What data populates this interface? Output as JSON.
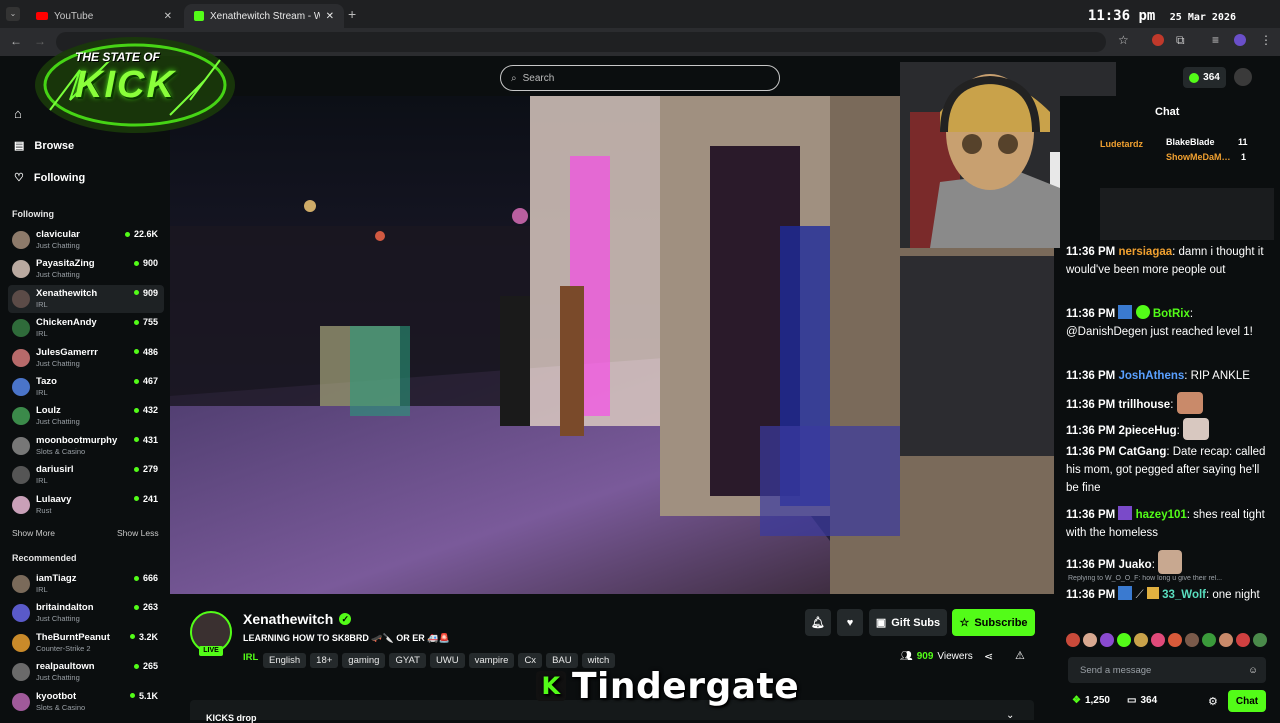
{
  "browser": {
    "tabs": [
      {
        "label": "YouTube",
        "icon": "youtube-icon"
      },
      {
        "label": "Xenathewitch Stream - Wa…",
        "icon": "kick-icon"
      }
    ],
    "clock_time": "11:36 pm",
    "clock_date": "25 Mar 2026"
  },
  "overlay_logo": {
    "line1": "THE STATE OF",
    "line2": "KICK"
  },
  "header": {
    "search_placeholder": "Search",
    "points": "364"
  },
  "sidebar": {
    "nav": [
      {
        "label": "Browse",
        "icon": "compass-icon"
      },
      {
        "label": "Following",
        "icon": "heart-icon"
      }
    ],
    "following_title": "Following",
    "following": [
      {
        "name": "clavicular",
        "category": "Just Chatting",
        "viewers": "22.6K",
        "color": "#8d7a6a"
      },
      {
        "name": "PayasitaZing",
        "category": "Just Chatting",
        "viewers": "900",
        "color": "#b9a9a0"
      },
      {
        "name": "Xenathewitch",
        "category": "IRL",
        "viewers": "909",
        "color": "#5b4b47"
      },
      {
        "name": "ChickenAndy",
        "category": "IRL",
        "viewers": "755",
        "color": "#2f6b3a"
      },
      {
        "name": "JulesGamerrr",
        "category": "Just Chatting",
        "viewers": "486",
        "color": "#b76a6a"
      },
      {
        "name": "Tazo",
        "category": "IRL",
        "viewers": "467",
        "color": "#4a74c9"
      },
      {
        "name": "Loulz",
        "category": "Just Chatting",
        "viewers": "432",
        "color": "#3b8a4a"
      },
      {
        "name": "moonbootmurphy",
        "category": "Slots & Casino",
        "viewers": "431",
        "color": "#777"
      },
      {
        "name": "dariusirl",
        "category": "IRL",
        "viewers": "279",
        "color": "#555"
      },
      {
        "name": "Lulaavy",
        "category": "Rust",
        "viewers": "241",
        "color": "#c9a0b8"
      }
    ],
    "show_more": "Show More",
    "show_less": "Show Less",
    "recommended_title": "Recommended",
    "recommended": [
      {
        "name": "iamTiagz",
        "category": "IRL",
        "viewers": "666",
        "color": "#7a6a5a"
      },
      {
        "name": "britaindalton",
        "category": "Just Chatting",
        "viewers": "263",
        "color": "#5a5ac9"
      },
      {
        "name": "TheBurntPeanut",
        "category": "Counter-Strike 2",
        "viewers": "3.2K",
        "color": "#c98a2a"
      },
      {
        "name": "realpaultown",
        "category": "Just Chatting",
        "viewers": "265",
        "color": "#6a6a6a"
      },
      {
        "name": "kyootbot",
        "category": "Slots & Casino",
        "viewers": "5.1K",
        "color": "#a05a9a"
      }
    ]
  },
  "stream": {
    "name": "Xenathewitch",
    "title": "LEARNING HOW TO SK8BRD 🛹🔪 OR ER 🚑🚨",
    "live_label": "LIVE",
    "tags": [
      "IRL",
      "English",
      "18+",
      "gaming",
      "GYAT",
      "UWU",
      "vampire",
      "Cx",
      "BAU",
      "witch"
    ],
    "viewers": "909",
    "viewers_label": "Viewers",
    "gift_label": "Gift Subs",
    "subscribe_label": "Subscribe",
    "below_text": "KICKS drop"
  },
  "chat": {
    "title": "Chat",
    "top_gifters": [
      {
        "name": "Ludetardz",
        "count": ""
      },
      {
        "name": "BlakeBlade",
        "count": "11"
      },
      {
        "name": "ShowMeDaM…",
        "count": "1"
      }
    ],
    "messages": [
      {
        "time": "11:36 PM",
        "user": "nersiagaa",
        "user_color": "#f0a030",
        "text": ": damn i thought it would've been more people out"
      },
      {
        "time": "11:36 PM",
        "user": "BotRix",
        "user_color": "#53fc18",
        "text": ": @DanishDegen just reached level 1!"
      },
      {
        "time": "11:36 PM",
        "user": "JoshAthens",
        "user_color": "#5aa0ff",
        "text": ": RIP ANKLE"
      },
      {
        "time": "11:36 PM",
        "user": "trillhouse",
        "user_color": "#ffffff",
        "text": ":"
      },
      {
        "time": "11:36 PM",
        "user": "2pieceHug",
        "user_color": "#ffffff",
        "text": ":"
      },
      {
        "time": "11:36 PM",
        "user": "CatGang",
        "user_color": "#ffffff",
        "text": ": Date recap: called his mom, got pegged after saying he'll be fine"
      },
      {
        "time": "11:36 PM",
        "user": "hazey101",
        "user_color": "#53fc18",
        "text": ": shes real tight with the homeless"
      },
      {
        "time": "11:36 PM",
        "user": "Juako",
        "user_color": "#ffffff",
        "text": ":"
      },
      {
        "time": "11:36 PM",
        "user": "33_Wolf",
        "user_color": "#5adfc0",
        "text": ": one night"
      }
    ],
    "reply_text": "Replying to W_O_O_F: how long u give their rel...",
    "input_placeholder": "Send a message",
    "points": "1,250",
    "viewers_small": "364",
    "chat_button": "Chat"
  },
  "caption": "Tindergate",
  "colors": {
    "kick_green": "#53fc18",
    "bg": "#0b0e0f",
    "panel": "#24292b"
  }
}
